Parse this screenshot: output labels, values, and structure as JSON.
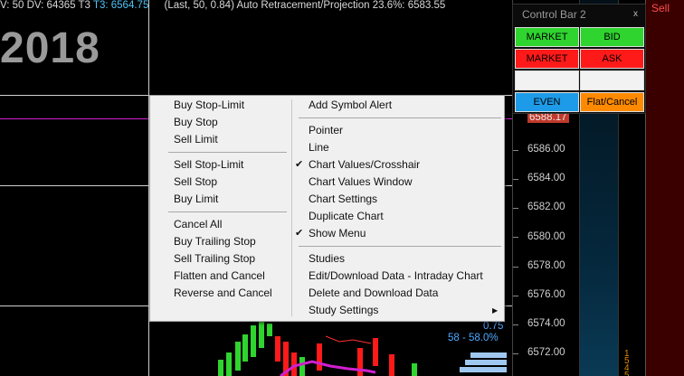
{
  "status_line": {
    "prefix": "V: 50 DV: 64365 T3",
    "t3_value": "T3: 6564.75",
    "last_info": "(Last, 50, 0.84)",
    "study_name": "Auto Retracement/Projection",
    "retrace_info": "23.6%: 6583.55"
  },
  "chart": {
    "year": "2018",
    "highlight_price": "6588.17",
    "price_labels": [
      "6586.00",
      "6584.00",
      "6582.00",
      "6580.00",
      "6578.00",
      "6576.00",
      "6574.00",
      "6572.00"
    ],
    "label_075": "0.75",
    "label_pct": "58 - 58.0%",
    "right_col_text": "1\n5\n4\n5"
  },
  "control_bar": {
    "title": "Control Bar 2",
    "close": "x",
    "buttons": {
      "market_buy": "MARKET",
      "bid": "BID",
      "market_sell": "MARKET",
      "ask": "ASK",
      "empty_left": "",
      "empty_right": "",
      "even": "EVEN",
      "flat_cancel": "Flat/Cancel"
    }
  },
  "sell_label": "Sell",
  "context_menu": {
    "left": {
      "group1": [
        "Buy Stop-Limit",
        "Buy Stop",
        "Sell Limit"
      ],
      "group2": [
        "Sell Stop-Limit",
        "Sell Stop",
        "Buy Limit"
      ],
      "group3": [
        "Cancel All",
        "Buy Trailing Stop",
        "Sell Trailing Stop",
        "Flatten and Cancel",
        "Reverse and Cancel"
      ]
    },
    "right": {
      "group1": [
        "Add Symbol Alert"
      ],
      "group2": [
        "Pointer",
        "Line",
        "Chart Values/Crosshair",
        "Chart Values Window",
        "Chart Settings",
        "Duplicate Chart",
        "Show Menu"
      ],
      "group3": [
        "Studies",
        "Edit/Download Data - Intraday Chart",
        "Delete and Download Data",
        "Study Settings"
      ]
    },
    "checkmark": "✔",
    "submenu_arrow": "▶"
  },
  "colors": {
    "green": "#2fd42f",
    "red": "#ff1a1a",
    "blue": "#1e9be8",
    "orange": "#ff8a00",
    "magenta": "#d020d0"
  }
}
